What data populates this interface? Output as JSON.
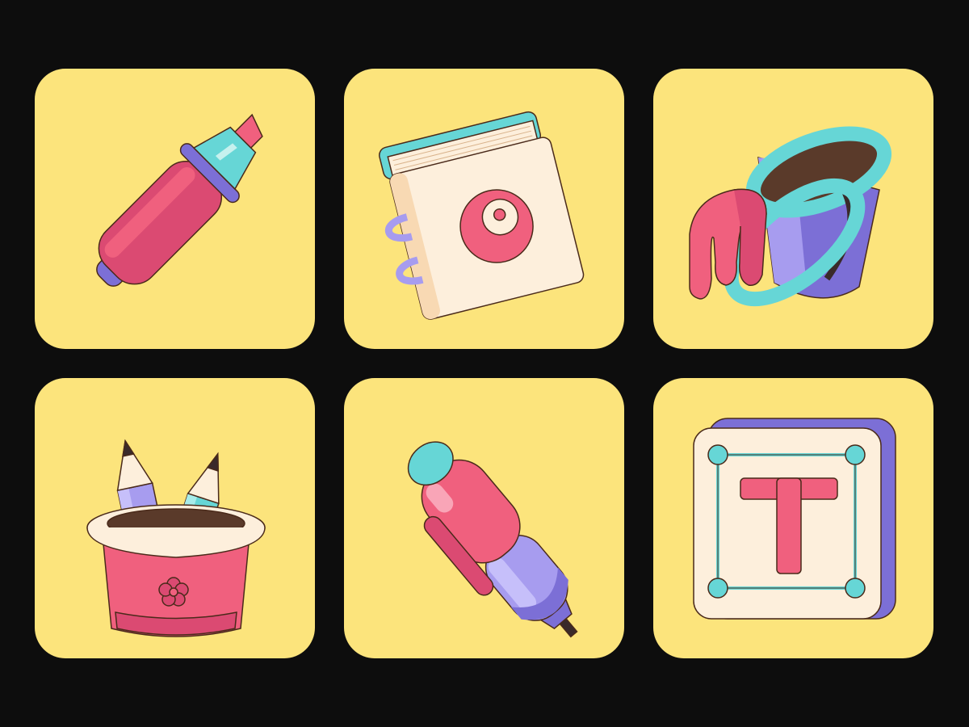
{
  "colors": {
    "background": "#0d0d0d",
    "tile": "#fce47c",
    "pink": "#f0607e",
    "pink_dark": "#db4a72",
    "teal": "#66d6d6",
    "purple": "#a79cef",
    "purple_dark": "#7c6fd6",
    "cream": "#fdefdc",
    "outline": "#4a2a1a"
  },
  "tiles": [
    {
      "icon": "highlighter-icon"
    },
    {
      "icon": "notebook-icon"
    },
    {
      "icon": "paint-bucket-icon"
    },
    {
      "icon": "pencil-cup-icon"
    },
    {
      "icon": "pen-icon"
    },
    {
      "icon": "text-tool-icon",
      "letter": "T"
    }
  ]
}
